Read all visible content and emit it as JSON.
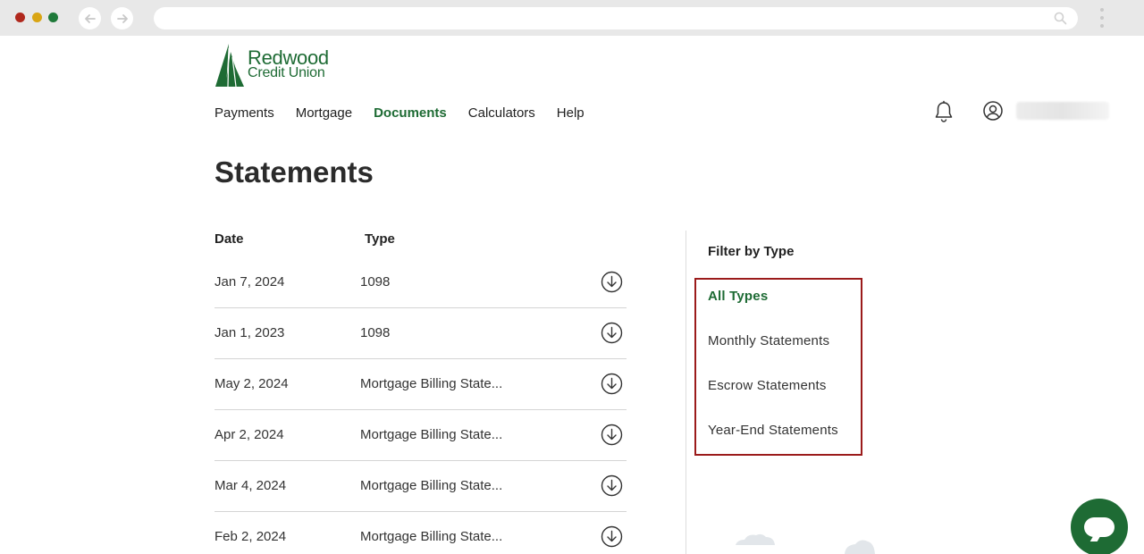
{
  "brand": {
    "name_line1": "Redwood",
    "name_line2": "Credit Union",
    "color": "#1e6b34"
  },
  "nav": {
    "items": [
      {
        "label": "Payments",
        "active": false
      },
      {
        "label": "Mortgage",
        "active": false
      },
      {
        "label": "Documents",
        "active": true
      },
      {
        "label": "Calculators",
        "active": false
      },
      {
        "label": "Help",
        "active": false
      }
    ]
  },
  "header": {
    "notification_icon": "bell-icon",
    "account_icon": "user-circle-icon"
  },
  "page": {
    "title": "Statements"
  },
  "table": {
    "columns": [
      "Date",
      "Type"
    ],
    "rows": [
      {
        "date": "Jan 7, 2024",
        "type": "1098"
      },
      {
        "date": "Jan 1, 2023",
        "type": "1098"
      },
      {
        "date": "May 2, 2024",
        "type": "Mortgage Billing State..."
      },
      {
        "date": "Apr 2, 2024",
        "type": "Mortgage Billing State..."
      },
      {
        "date": "Mar 4, 2024",
        "type": "Mortgage Billing State..."
      },
      {
        "date": "Feb 2, 2024",
        "type": "Mortgage Billing State..."
      }
    ],
    "row_icon": "download-icon"
  },
  "filter": {
    "title": "Filter by Type",
    "options": [
      {
        "label": "All Types",
        "selected": true
      },
      {
        "label": "Monthly Statements",
        "selected": false
      },
      {
        "label": "Escrow Statements",
        "selected": false
      },
      {
        "label": "Year-End Statements",
        "selected": false
      }
    ],
    "highlight_color": "#9b1b1b"
  },
  "chat": {
    "icon": "chat-bubble-icon"
  }
}
